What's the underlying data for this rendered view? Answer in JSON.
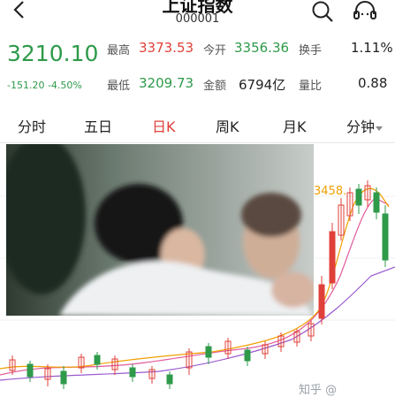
{
  "header": {
    "title": "上证指数",
    "code": "000001"
  },
  "quote": {
    "price": "3210.10",
    "change": "-151.20  -4.50%",
    "high_label": "最高",
    "high_value": "3373.53",
    "open_label": "今开",
    "open_value": "3356.36",
    "turnover_label": "换手",
    "turnover_value": "1.11%",
    "low_label": "最低",
    "low_value": "3209.73",
    "amount_label": "金额",
    "amount_value": "6794亿",
    "ratio_label": "量比",
    "ratio_value": "0.88"
  },
  "tabs": [
    "分时",
    "五日",
    "日K",
    "周K",
    "月K",
    "分钟"
  ],
  "active_tab": "日K",
  "chart": {
    "high_marker": "3458.",
    "colors": {
      "up": "#e0403a",
      "down": "#2e9a4a",
      "ma5": "#f0a000",
      "ma10": "#e05a9a",
      "ma20": "#9a5ad0"
    }
  },
  "watermark": "知乎 @"
}
